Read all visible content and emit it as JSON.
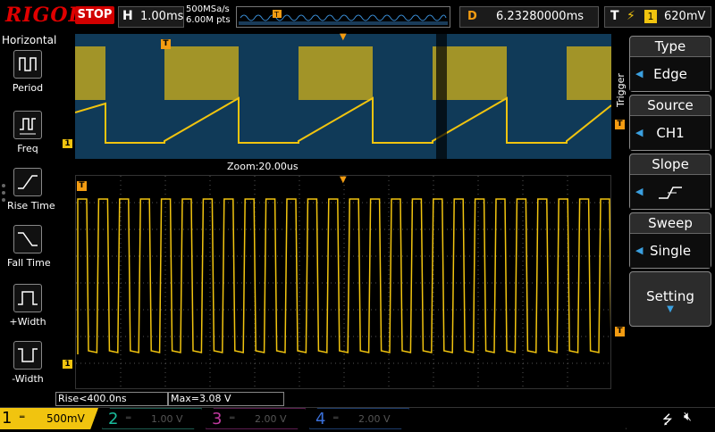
{
  "brand": {
    "logo": "RIGOL",
    "run_state": "STOP"
  },
  "timebase": {
    "key": "H",
    "value": "1.00ms"
  },
  "acquisition": {
    "rate": "500MSa/s",
    "points": "6.00M pts"
  },
  "delay": {
    "key": "D",
    "value": "6.23280000ms"
  },
  "trigger_status": {
    "key": "T",
    "channel": "1",
    "level": "620mV"
  },
  "horizontal_menu": {
    "title": "Horizontal",
    "items": [
      {
        "label": "Period",
        "icon": "period-icon"
      },
      {
        "label": "Freq",
        "icon": "freq-icon"
      },
      {
        "label": "Rise Time",
        "icon": "rise-time-icon"
      },
      {
        "label": "Fall Time",
        "icon": "fall-time-icon"
      },
      {
        "label": "+Width",
        "icon": "pos-width-icon"
      },
      {
        "label": "-Width",
        "icon": "neg-width-icon"
      }
    ]
  },
  "zoom_label": "Zoom:20.00us",
  "measurements": {
    "rise": "Rise<400.0ns",
    "max": "Max=3.08 V"
  },
  "trigger_menu": {
    "side_label": "Trigger",
    "items": [
      {
        "title": "Type",
        "value": "Edge"
      },
      {
        "title": "Source",
        "value": "CH1"
      },
      {
        "title": "Slope",
        "value": "rising-edge-icon"
      },
      {
        "title": "Sweep",
        "value": "Single"
      },
      {
        "title": "Setting",
        "value": ""
      }
    ]
  },
  "channels": [
    {
      "num": "1",
      "scale": "500mV",
      "color": "#f1c40f",
      "active": true
    },
    {
      "num": "2",
      "scale": "1.00 V",
      "color": "#1abc9c",
      "active": false
    },
    {
      "num": "3",
      "scale": "2.00 V",
      "color": "#c0399f",
      "active": false
    },
    {
      "num": "4",
      "scale": "2.00 V",
      "color": "#3a6fd8",
      "active": false
    }
  ],
  "colors": {
    "ch1": "#f1c40f",
    "trigger": "#f39c12",
    "brand": "#e00000",
    "upper_bg": "#103a58"
  }
}
